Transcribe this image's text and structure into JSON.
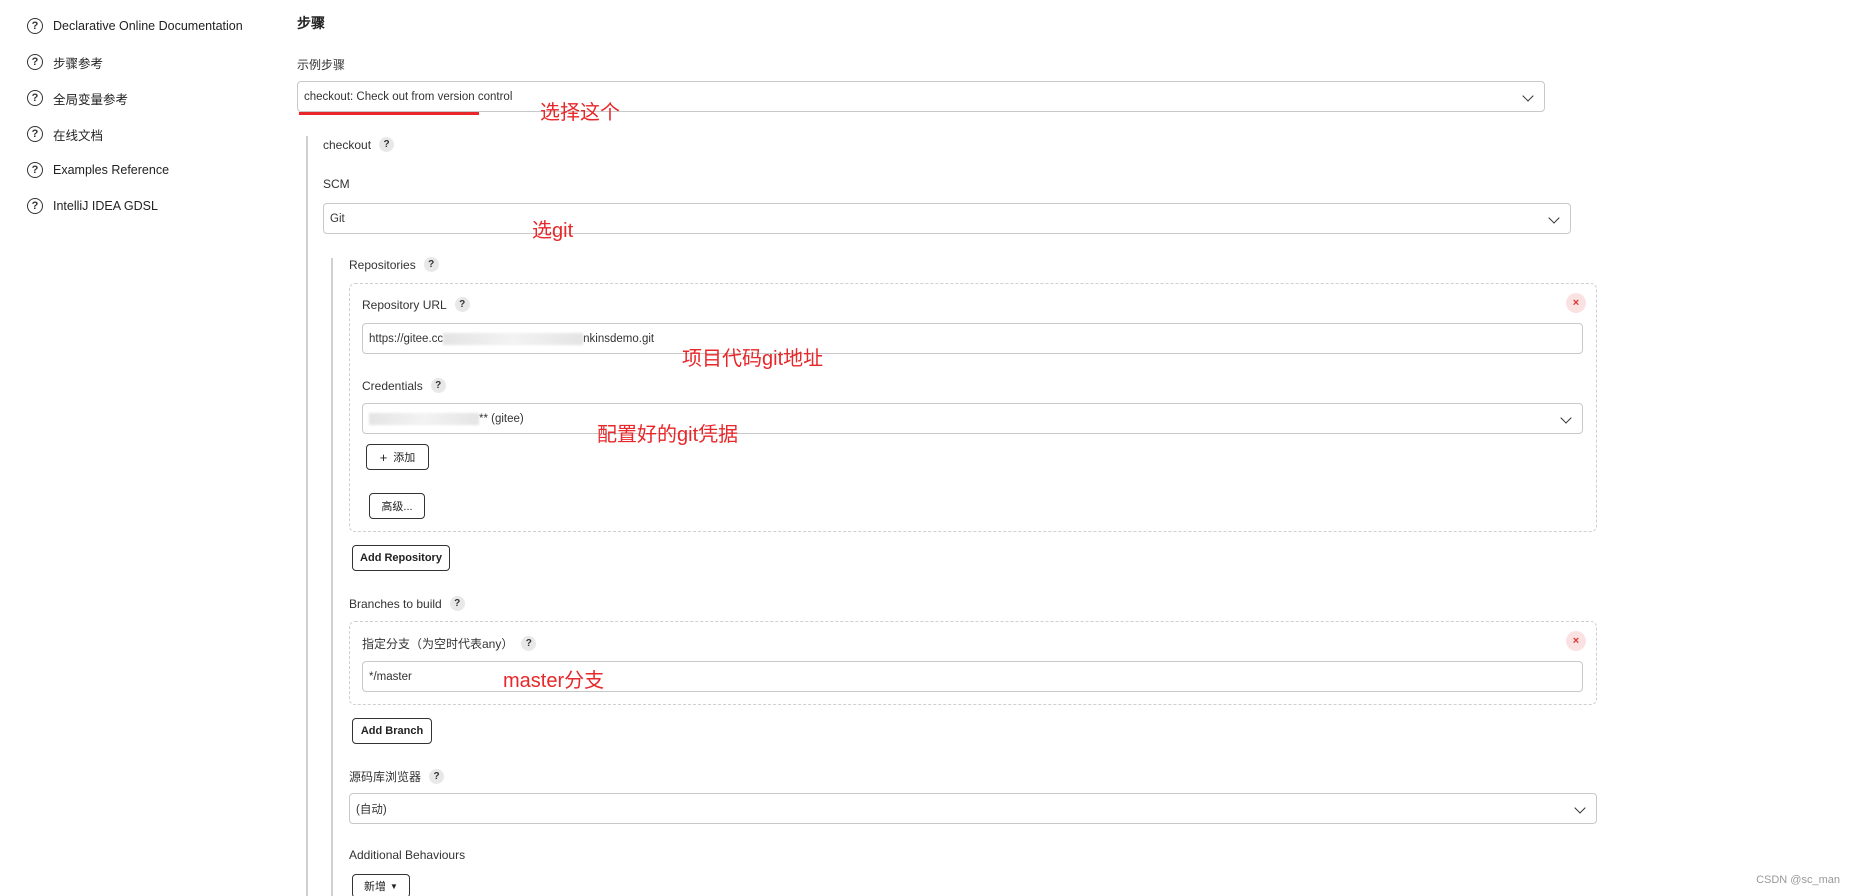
{
  "sidebar": {
    "items": [
      {
        "label": "Declarative Online Documentation",
        "icon": "help-circle-icon"
      },
      {
        "label": "步骤参考",
        "icon": "help-circle-icon"
      },
      {
        "label": "全局变量参考",
        "icon": "help-circle-icon"
      },
      {
        "label": "在线文档",
        "icon": "help-circle-icon"
      },
      {
        "label": "Examples Reference",
        "icon": "help-circle-icon"
      },
      {
        "label": "IntelliJ IDEA GDSL",
        "icon": "help-circle-icon"
      }
    ]
  },
  "main": {
    "section_title": "步骤",
    "sample_step_label": "示例步骤",
    "sample_step_value": "checkout: Check out from version control",
    "checkout_label": "checkout",
    "scm_label": "SCM",
    "scm_value": "Git",
    "repositories_label": "Repositories",
    "repo_url_label": "Repository URL",
    "repo_url_value_start": "https://gitee.cc",
    "repo_url_value_end": "nkinsdemo.git",
    "credentials_label": "Credentials",
    "credentials_value_suffix": "** (gitee)",
    "add_credentials_label": "添加",
    "advanced_label": "高级...",
    "add_repository_label": "Add Repository",
    "branches_label": "Branches to build",
    "branch_spec_label": "指定分支（为空时代表any）",
    "branch_spec_value": "*/master",
    "add_branch_label": "Add Branch",
    "repo_browser_label": "源码库浏览器",
    "repo_browser_value": "(自动)",
    "additional_behaviours_label": "Additional Behaviours",
    "new_behaviour_label": "新增"
  },
  "annotations": {
    "select_this": "选择这个",
    "select_git": "选git",
    "git_url": "项目代码git地址",
    "git_credentials": "配置好的git凭据",
    "master_branch": "master分支",
    "color": "#e8272a"
  },
  "watermark": "CSDN @sc_man"
}
